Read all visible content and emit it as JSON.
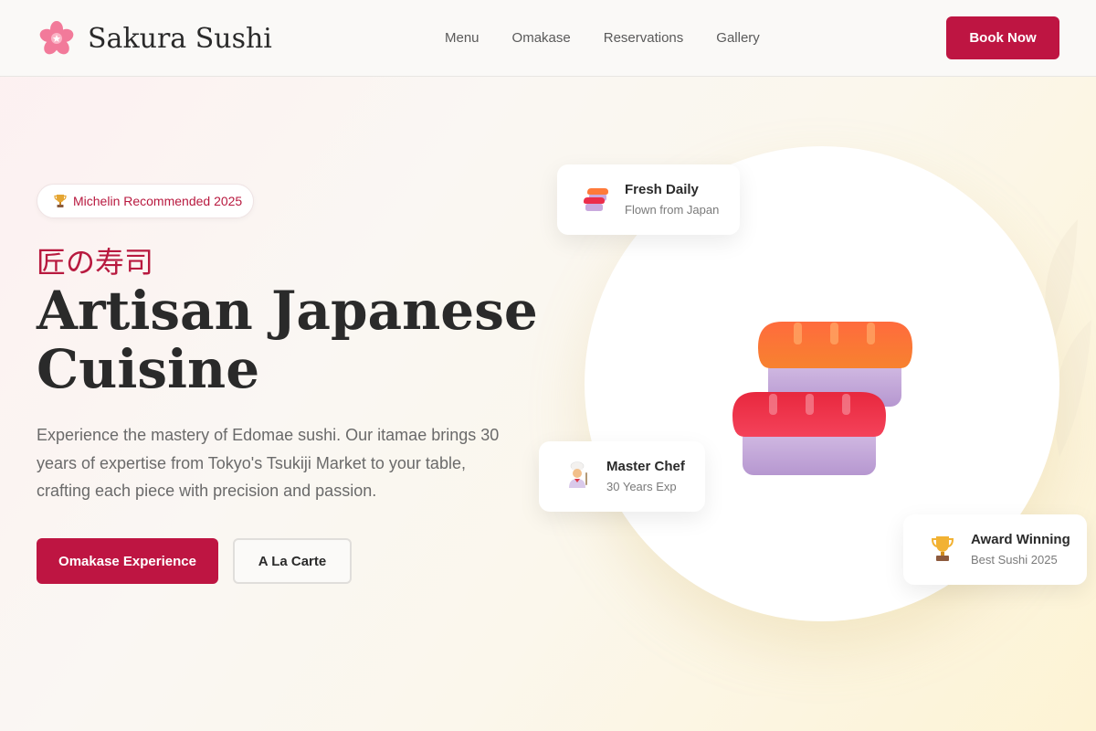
{
  "header": {
    "brand": "Sakura Sushi",
    "nav": [
      "Menu",
      "Omakase",
      "Reservations",
      "Gallery"
    ],
    "cta": "Book Now"
  },
  "hero": {
    "badge": "Michelin Recommended 2025",
    "jp_title": "匠の寿司",
    "title_line1": "Artisan Japanese",
    "title_line2": "Cuisine",
    "description": "Experience the mastery of Edomae sushi. Our itamae brings 30 years of expertise from Tokyo's Tsukiji Market to your table, crafting each piece with precision and passion.",
    "primary_button": "Omakase Experience",
    "secondary_button": "A La Carte"
  },
  "cards": {
    "fresh": {
      "title": "Fresh Daily",
      "subtitle": "Flown from Japan",
      "icon": "sushi-icon"
    },
    "chef": {
      "title": "Master Chef",
      "subtitle": "30 Years Exp",
      "icon": "chef-icon"
    },
    "award": {
      "title": "Award Winning",
      "subtitle": "Best Sushi 2025",
      "icon": "trophy-icon"
    }
  },
  "colors": {
    "accent": "#be1542",
    "text": "#2a2a2a",
    "muted": "#6a6a6a"
  }
}
